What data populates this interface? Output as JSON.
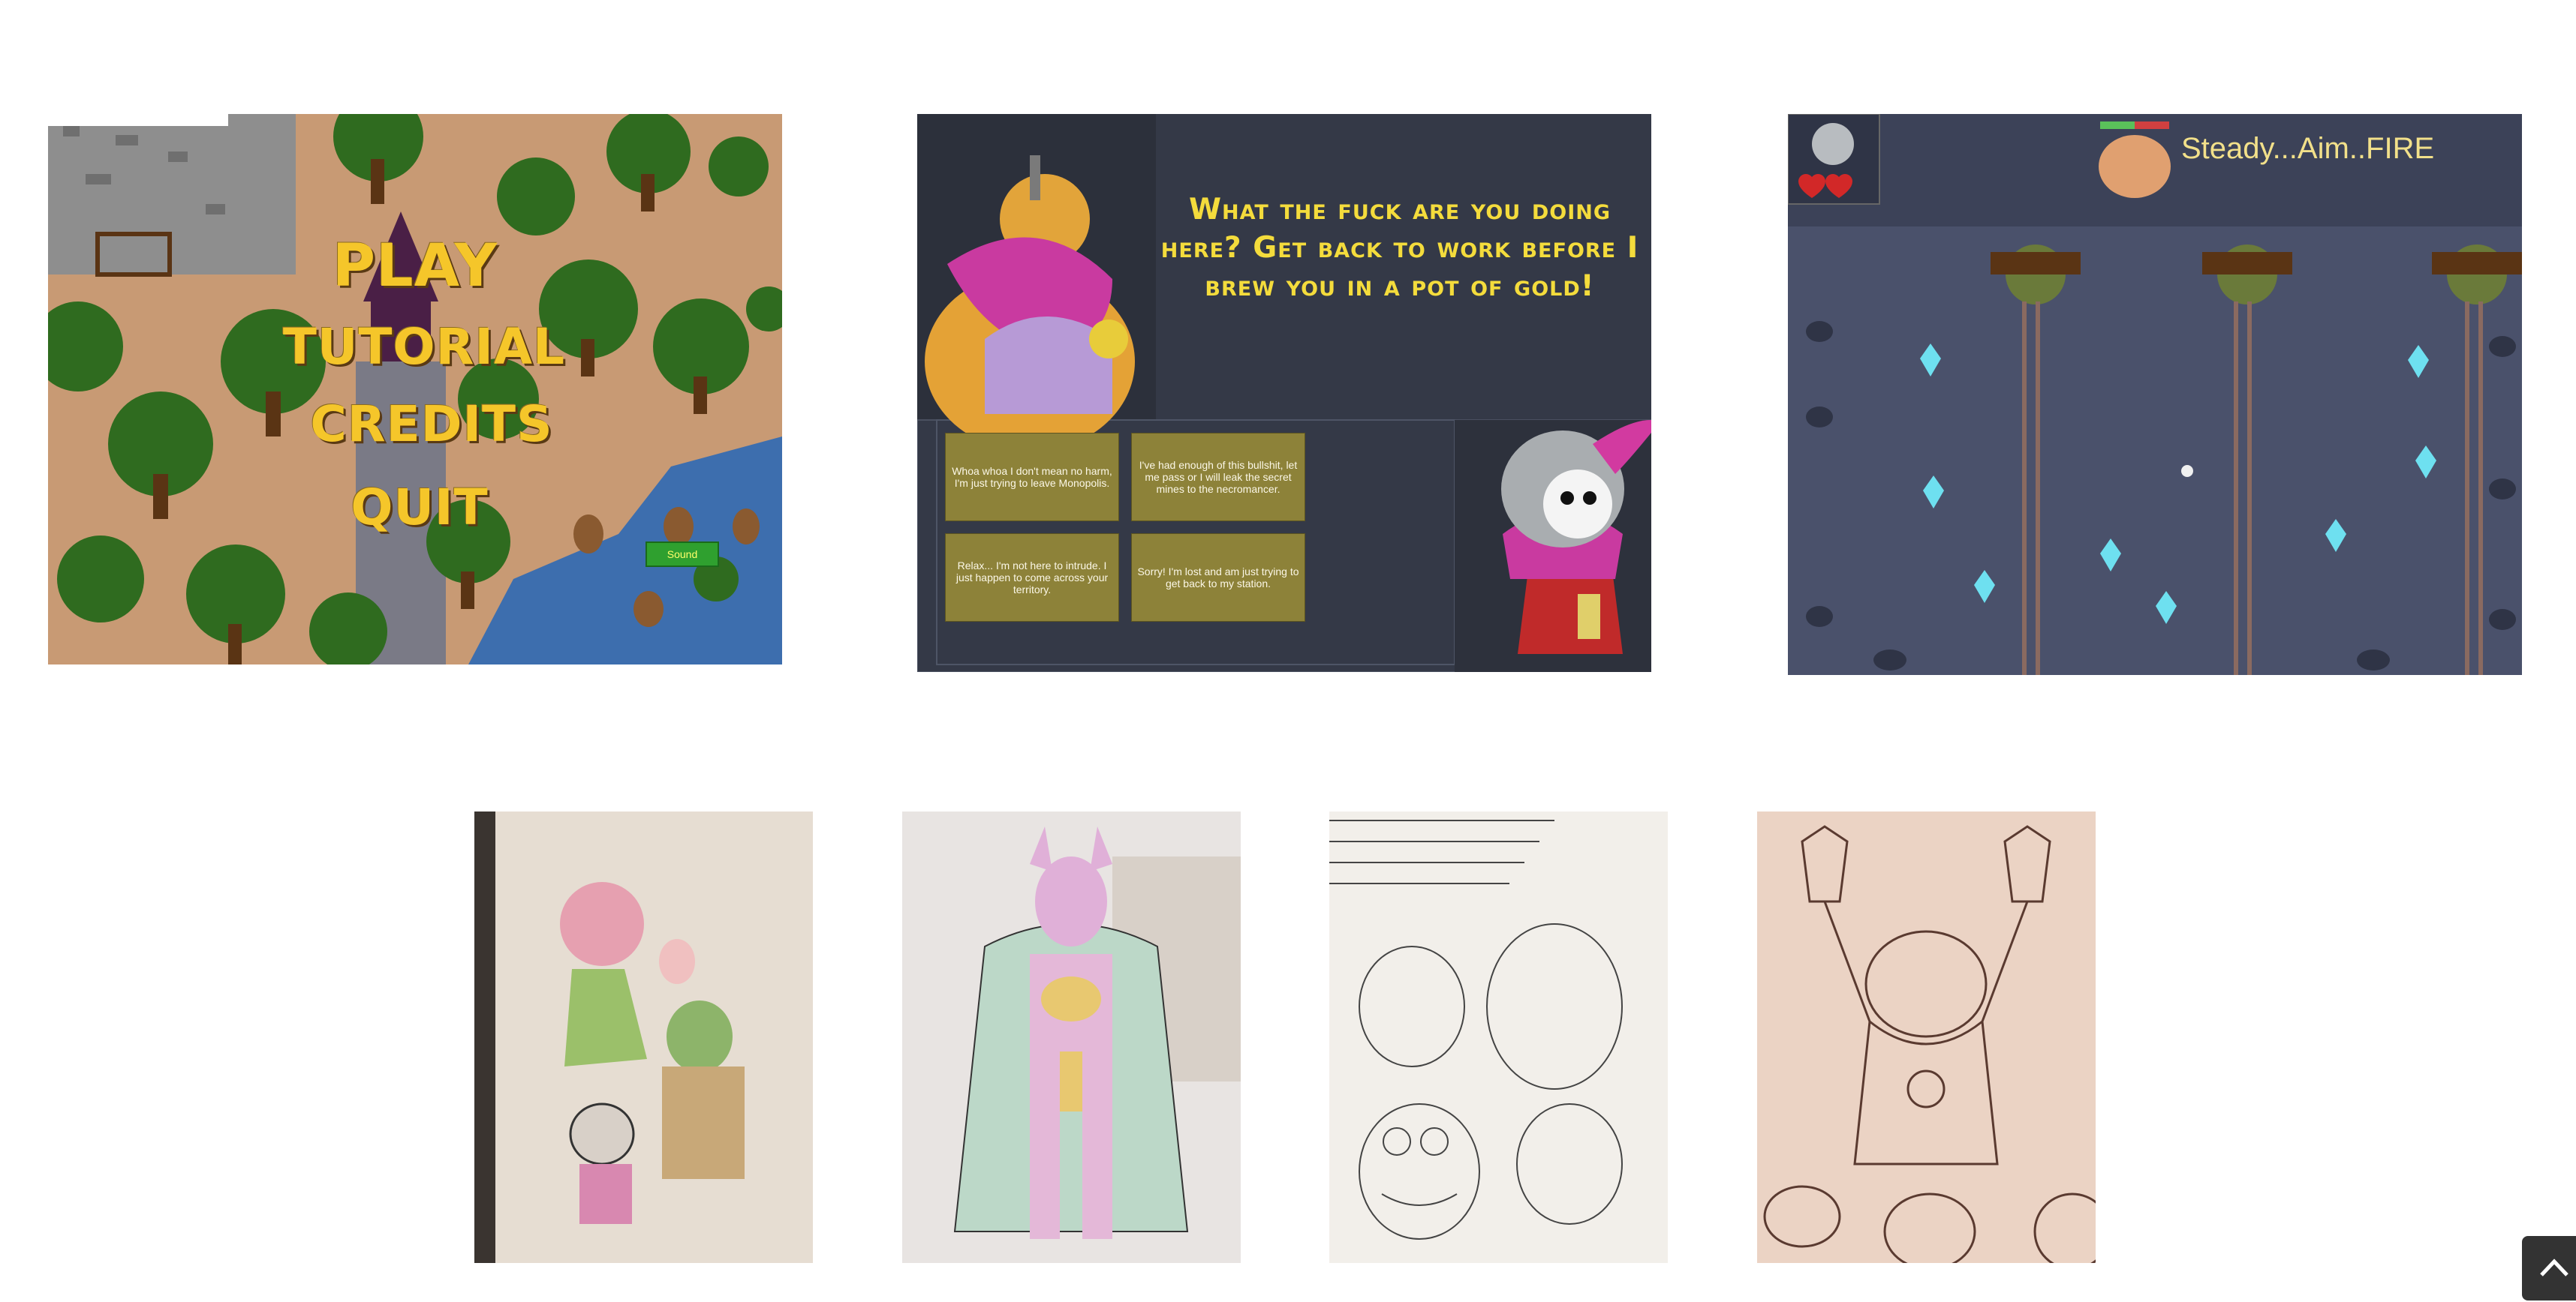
{
  "main_menu": {
    "items": [
      "PLAY",
      "TUTORIAL",
      "CREDITS",
      "QUIT"
    ],
    "sound_label": "Sound",
    "colors": {
      "menu_text": "#f5c62a",
      "grass": "#2f6b1f",
      "water": "#3d6eae",
      "sand": "#c89a74"
    }
  },
  "dialogue": {
    "npc_line": "What the fuck are you doing here? Get back to work before I brew you in a pot of gold!",
    "choices": [
      "Whoa whoa I don't mean no harm, I'm just trying to leave Monopolis.",
      "I've had enough of this bullshit, let me pass or I will leak the secret mines to the necromancer.",
      "Relax... I'm not here to intrude. I just happen to come across your territory.",
      "Sorry! I'm lost and am just trying to get back to my station."
    ],
    "colors": {
      "background": "#343947",
      "npc_text": "#f4dc3c",
      "choice_bg": "#8d8239"
    }
  },
  "mine": {
    "banner_text": "Steady...Aim..FIRE",
    "hearts": 2,
    "colors": {
      "background": "#48506a",
      "crystal": "#6ee0f0"
    }
  },
  "sketches": [
    "sketch-party",
    "sketch-horned-villain",
    "sketch-character-notes",
    "sketch-troll"
  ],
  "scroll_top_icon": "chevron-up-icon"
}
